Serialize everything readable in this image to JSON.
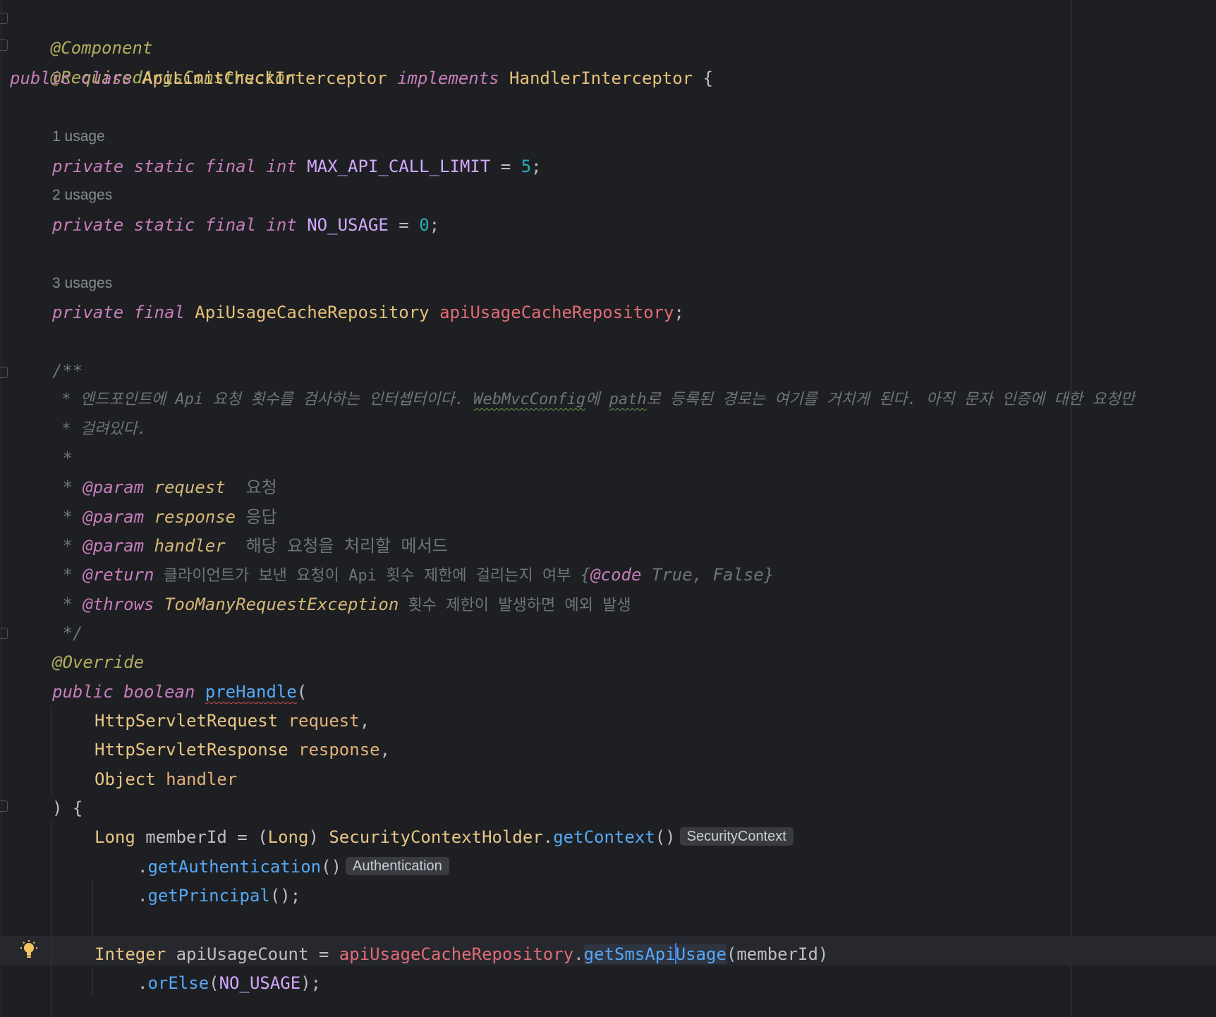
{
  "editor": {
    "line1": "@Component",
    "line2": "@RequiredArgsConstructor",
    "line3": {
      "kw_public": "public",
      "kw_class": "class",
      "class_name": "ApiLimitCheckInterceptor",
      "kw_implements": "implements",
      "iface": "HandlerInterceptor",
      "brace": " {"
    },
    "hint1": "1 usage",
    "field1": {
      "mods": "private static final int",
      "name": "MAX_API_CALL_LIMIT",
      "eq": " = ",
      "value": "5",
      "end": ";"
    },
    "hint2": "2 usages",
    "field2": {
      "mods": "private static final int",
      "name": "NO_USAGE",
      "eq": " = ",
      "value": "0",
      "end": ";"
    },
    "hint3": "3 usages",
    "field3": {
      "mods": "private final",
      "type": "ApiUsageCacheRepository",
      "name": "apiUsageCacheRepository",
      "end": ";"
    },
    "doc": {
      "open": "/**",
      "l1a": " * 엔드포인트에 Api 요청 횟수를 검사하는 인터셉터이다. ",
      "l1b": "WebMvcConfig",
      "l1c": "에 ",
      "l1d": "path",
      "l1e": "로 등록된 경로는 여기를 거치게 된다. 아직 문자 인증에 대한 요청만",
      "l2": " * 걸려있다.",
      "l3": " *",
      "p1": {
        "star": " * ",
        "tag": "@param",
        "name": "request",
        "desc": "  요청"
      },
      "p2": {
        "star": " * ",
        "tag": "@param",
        "name": "response",
        "desc": " 응답"
      },
      "p3": {
        "star": " * ",
        "tag": "@param",
        "name": "handler",
        "desc": "  해당 요청을 처리할 메서드"
      },
      "ret": {
        "star": " * ",
        "tag": "@return",
        "desc": " 클라이언트가 보낸 요청이 Api 횟수 제한에 걸리는지 여부 ",
        "open": "{",
        "code": "@code",
        "codev": " True, False",
        "close": "}"
      },
      "thr": {
        "star": " * ",
        "tag": "@throws",
        "exc": "TooManyRequestException",
        "desc": " 횟수 제한이 발생하면 예외 발생"
      },
      "close": " */"
    },
    "override": "@Override",
    "sig": {
      "mods": "public boolean",
      "name": "preHandle",
      "paren": "("
    },
    "p_req": {
      "type": "HttpServletRequest",
      "name": "request",
      "sep": ","
    },
    "p_res": {
      "type": "HttpServletResponse",
      "name": "response",
      "sep": ","
    },
    "p_han": {
      "type": "Object",
      "name": "handler"
    },
    "sig_close": ") {",
    "l_member": {
      "type": "Long",
      "rest1": " memberId = (",
      "cast": "Long",
      "rest2": ") ",
      "holder": "SecurityContextHolder",
      "dot": ".",
      "method": "getContext",
      "call": "()",
      "inlay": "SecurityContext"
    },
    "l_auth": {
      "dot": ".",
      "method": "getAuthentication",
      "call": "()",
      "inlay": "Authentication"
    },
    "l_principal": {
      "dot": ".",
      "method": "getPrincipal",
      "call": "();"
    },
    "l_usage": {
      "type": "Integer",
      "rest1": " apiUsageCount = ",
      "field": "apiUsageCacheRepository",
      "dot": ".",
      "method_a": "getSmsApi",
      "method_b": "Usage",
      "args": "(memberId)"
    },
    "l_orelse": {
      "dot": ".",
      "method": "orElse",
      "open": "(",
      "const": "NO_USAGE",
      "close": ");"
    }
  },
  "colors": {
    "background": "#1e1f22",
    "keyword": "#c77dbb",
    "annotation": "#b3ae60",
    "field": "#e06c75",
    "method": "#56a8f5",
    "number": "#2aacb8",
    "comment": "#6f737a"
  }
}
